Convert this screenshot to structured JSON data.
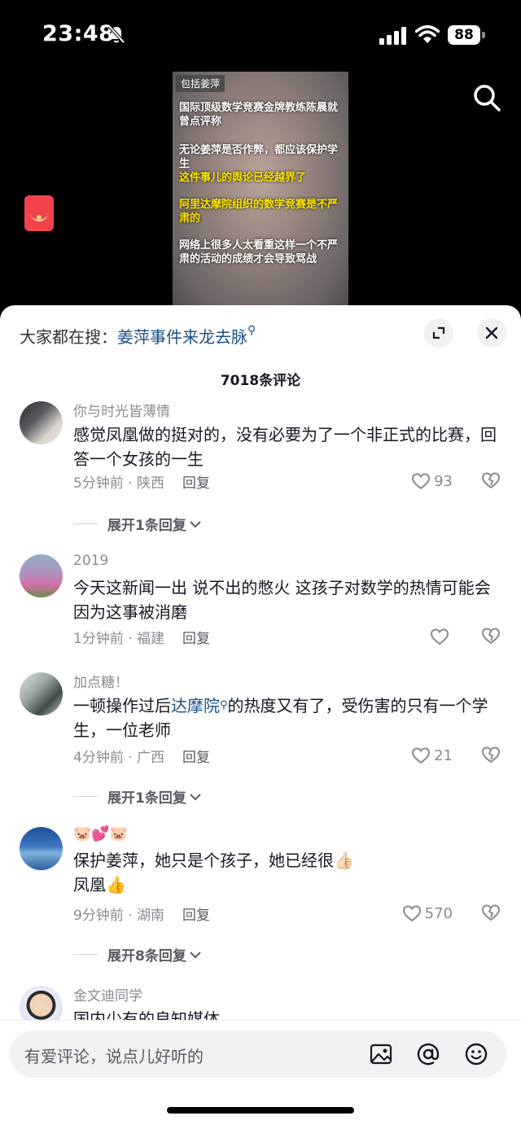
{
  "status_bar": {
    "time": "23:48",
    "battery": "88"
  },
  "video": {
    "tag": "包括姜萍",
    "lines": [
      "国际顶级数学竞赛金牌教练陈晨就曾点评称",
      "无论姜萍是否作弊，都应该保护学生",
      "这件事儿的舆论已经越界了",
      "阿里达摩院组织的数学竞赛是不严肃的",
      "网络上很多人太看重这样一个不严肃的活动的成绩才会导致骂战"
    ]
  },
  "sheet": {
    "search_label": "大家都在搜：",
    "search_link": "姜萍事件来龙去脉",
    "comment_count": "7018条评论"
  },
  "comments": [
    {
      "name": "你与时光皆薄情",
      "text": "感觉凤凰做的挺对的，没有必要为了一个非正式的比赛，回答一个女孩的一生",
      "time": "5分钟前 · 陕西",
      "reply": "回复",
      "likes": "93",
      "expand": "展开1条回复"
    },
    {
      "name": "2019",
      "text": "今天这新闻一出  说不出的憋火  这孩子对数学的热情可能会因为这事被消磨",
      "time": "1分钟前 · 福建",
      "reply": "回复",
      "likes": ""
    },
    {
      "name": "加点糖！",
      "text_before": "一顿操作过后",
      "tag": "达摩院",
      "text_after": "的热度又有了，受伤害的只有一个学生，一位老师",
      "time": "4分钟前 · 广西",
      "reply": "回复",
      "likes": "21",
      "expand": "展开1条回复"
    },
    {
      "name": "🐷💕🐷",
      "text_line1": "保护姜萍，她只是个孩子，她已经很👍🏻",
      "text_line2": "凤凰👍",
      "time": "9分钟前 · 湖南",
      "reply": "回复",
      "likes": "570",
      "expand": "展开8条回复"
    },
    {
      "name": "金文迪同学",
      "text": "国内少有的良知媒体"
    }
  ],
  "input": {
    "placeholder": "有爱评论，说点儿好听的"
  }
}
